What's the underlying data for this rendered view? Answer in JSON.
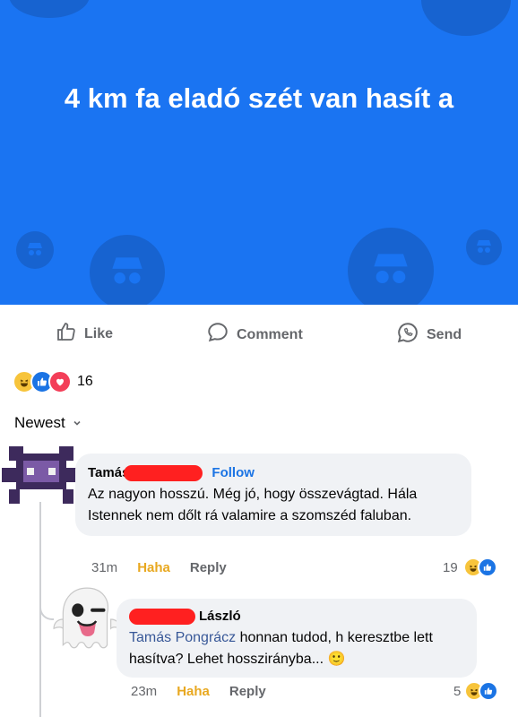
{
  "post": {
    "text": "4 km fa eladó szét van hasít a",
    "background": "#1a74f2"
  },
  "actions": {
    "like_label": "Like",
    "comment_label": "Comment",
    "send_label": "Send"
  },
  "reactions": {
    "icons": [
      "haha-icon",
      "like-icon",
      "love-icon"
    ],
    "count": "16"
  },
  "sort": {
    "label": "Newest"
  },
  "comments": [
    {
      "author": "Tamás",
      "follow_label": "Follow",
      "text": "Az nagyon hosszú. Még jó, hogy összevágtad. Hála Istennek nem dőlt rá valamire a szomszéd faluban.",
      "time": "31m",
      "haha_label": "Haha",
      "reply_label": "Reply",
      "reaction_count": "19"
    },
    {
      "author": "László",
      "mention": "Tamás Pongrácz",
      "text": " honnan tudod, h keresztbe lett hasítva? Lehet hosszirányba... 🙂",
      "time": "23m",
      "haha_label": "Haha",
      "reply_label": "Reply",
      "reaction_count": "5"
    }
  ],
  "colors": {
    "accent": "#1b74e4",
    "redaction": "#ff2020",
    "haha": "#e8a820"
  }
}
